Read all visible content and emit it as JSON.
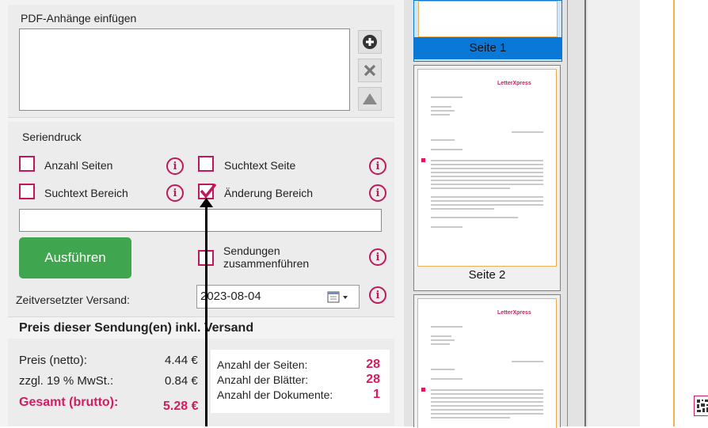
{
  "attachments": {
    "title": "PDF-Anhänge einfügen",
    "buttons": {
      "add": "add-icon",
      "remove": "close-icon",
      "move_up": "arrow-up-icon"
    }
  },
  "serial_print": {
    "title": "Seriendruck",
    "options": [
      {
        "label": "Anzahl Seiten",
        "checked": false
      },
      {
        "label": "Suchtext Seite",
        "checked": false
      },
      {
        "label": "Suchtext Bereich",
        "checked": false
      },
      {
        "label": "Änderung Bereich",
        "checked": true
      }
    ],
    "search_value": "",
    "run_button": "Ausführen",
    "merge_label_line1": "Sendungen",
    "merge_label_line2": "zusammenführen",
    "merge_checked": false,
    "delayed_label": "Zeitversetzter Versand:",
    "date_value": "2023-08-04",
    "info_glyph": "i"
  },
  "price": {
    "title": "Preis dieser Sendung(en) inkl. Versand",
    "net_label": "Preis (netto):",
    "net_value": "4.44 €",
    "vat_label": "zzgl. 19 % MwSt.:",
    "vat_value": "0.84 €",
    "total_label": "Gesamt (brutto):",
    "total_value": "5.28 €"
  },
  "stats": {
    "pages_label": "Anzahl der Seiten:",
    "pages_value": "28",
    "sheets_label": "Anzahl der Blätter:",
    "sheets_value": "28",
    "documents_label": "Anzahl der Dokumente:",
    "documents_value": "1"
  },
  "thumbnails": {
    "pages": [
      {
        "label": "Seite 1",
        "selected": true
      },
      {
        "label": "Seite 2",
        "selected": false
      }
    ],
    "logo_text": "LetterXpress"
  },
  "colors": {
    "accent": "#d81b60",
    "run_button": "#3fa54e",
    "selected": "#0a78d7"
  }
}
